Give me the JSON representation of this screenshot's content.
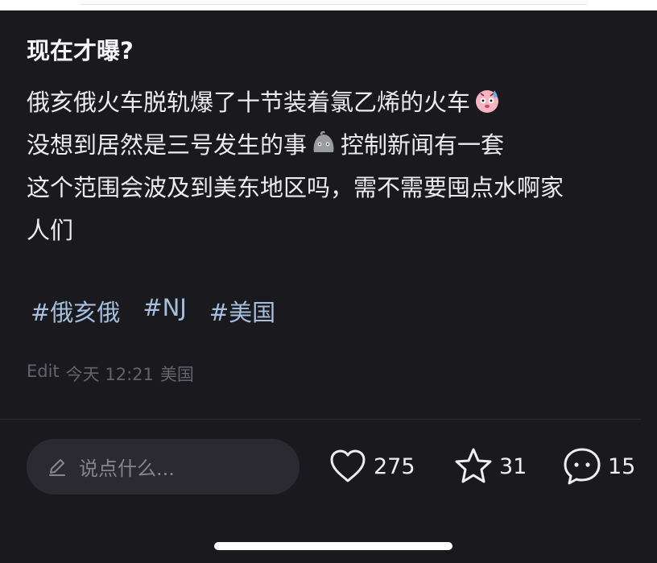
{
  "post": {
    "title": "现在才曝?",
    "lines": [
      {
        "text": "俄亥俄火车脱轨爆了十节装着氯乙烯的火车",
        "emoji": "sweating-face-emoji"
      },
      {
        "text_before": "没想到居然是三号发生的事",
        "emoji": "gray-face-emoji",
        "text_after": "控制新闻有一套"
      },
      {
        "text": "这个范围会波及到美东地区吗，需不需要囤点水啊家"
      },
      {
        "text": "人们"
      }
    ],
    "tags": [
      "#俄亥俄",
      "#NJ",
      "#美国"
    ],
    "meta": {
      "edit": "Edit",
      "time": "今天 12:21",
      "location": "美国"
    }
  },
  "actions": {
    "comment_placeholder": "说点什么...",
    "like_count": "275",
    "star_count": "31",
    "comment_count": "15"
  },
  "colors": {
    "background": "#1a191e",
    "tag": "#a6bfdd",
    "meta": "#64636b",
    "input_bg": "#2b2a30"
  }
}
